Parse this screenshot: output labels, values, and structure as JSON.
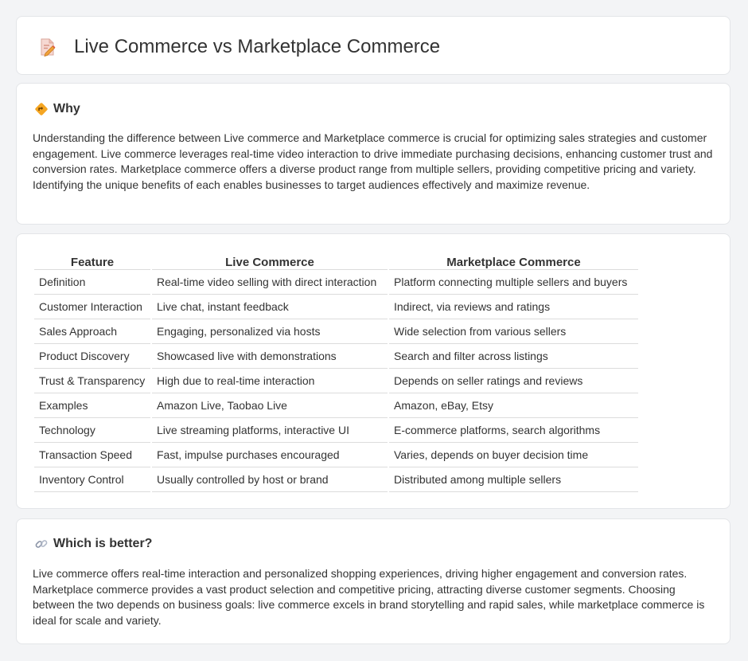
{
  "header": {
    "icon": "document-edit-icon",
    "title": "Live Commerce vs Marketplace Commerce"
  },
  "why": {
    "icon": "diamond-direction-icon",
    "heading": "Why",
    "text": "Understanding the difference between Live commerce and Marketplace commerce is crucial for optimizing sales strategies and customer engagement. Live commerce leverages real-time video interaction to drive immediate purchasing decisions, enhancing customer trust and conversion rates. Marketplace commerce offers a diverse product range from multiple sellers, providing competitive pricing and variety. Identifying the unique benefits of each enables businesses to target audiences effectively and maximize revenue."
  },
  "table": {
    "headers": [
      "Feature",
      "Live Commerce",
      "Marketplace Commerce"
    ],
    "rows": [
      [
        "Definition",
        "Real-time video selling with direct interaction",
        "Platform connecting multiple sellers and buyers"
      ],
      [
        "Customer Interaction",
        "Live chat, instant feedback",
        "Indirect, via reviews and ratings"
      ],
      [
        "Sales Approach",
        "Engaging, personalized via hosts",
        "Wide selection from various sellers"
      ],
      [
        "Product Discovery",
        "Showcased live with demonstrations",
        "Search and filter across listings"
      ],
      [
        "Trust & Transparency",
        "High due to real-time interaction",
        "Depends on seller ratings and reviews"
      ],
      [
        "Examples",
        "Amazon Live, Taobao Live",
        "Amazon, eBay, Etsy"
      ],
      [
        "Technology",
        "Live streaming platforms, interactive UI",
        "E-commerce platforms, search algorithms"
      ],
      [
        "Transaction Speed",
        "Fast, impulse purchases encouraged",
        "Varies, depends on buyer decision time"
      ],
      [
        "Inventory Control",
        "Usually controlled by host or brand",
        "Distributed among multiple sellers"
      ]
    ]
  },
  "better": {
    "icon": "link-icon",
    "heading": "Which is better?",
    "text": "Live commerce offers real-time interaction and personalized shopping experiences, driving higher engagement and conversion rates. Marketplace commerce provides a vast product selection and competitive pricing, attracting diverse customer segments. Choosing between the two depends on business goals: live commerce excels in brand storytelling and rapid sales, while marketplace commerce is ideal for scale and variety."
  }
}
